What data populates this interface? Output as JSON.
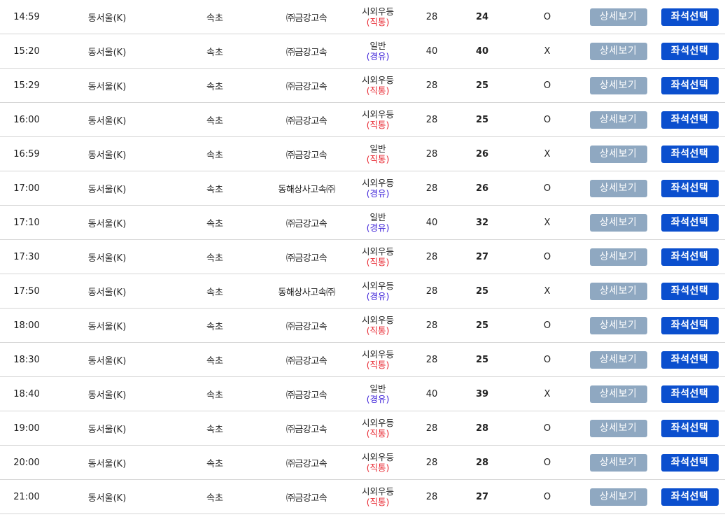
{
  "rows": [
    {
      "time": "14:59",
      "origin": "동서울(K)",
      "destination": "속초",
      "company": "㈜금강고속",
      "grade": "시외우등",
      "route": "(직통)",
      "route_type": "direct",
      "total_seats": "28",
      "remaining": "24",
      "mark": "O",
      "detail_label": "상세보기",
      "seat_label": "좌석선택"
    },
    {
      "time": "15:20",
      "origin": "동서울(K)",
      "destination": "속초",
      "company": "㈜금강고속",
      "grade": "일반",
      "route": "(경유)",
      "route_type": "via",
      "total_seats": "40",
      "remaining": "40",
      "mark": "X",
      "detail_label": "상세보기",
      "seat_label": "좌석선택"
    },
    {
      "time": "15:29",
      "origin": "동서울(K)",
      "destination": "속초",
      "company": "㈜금강고속",
      "grade": "시외우등",
      "route": "(직통)",
      "route_type": "direct",
      "total_seats": "28",
      "remaining": "25",
      "mark": "O",
      "detail_label": "상세보기",
      "seat_label": "좌석선택"
    },
    {
      "time": "16:00",
      "origin": "동서울(K)",
      "destination": "속초",
      "company": "㈜금강고속",
      "grade": "시외우등",
      "route": "(직통)",
      "route_type": "direct",
      "total_seats": "28",
      "remaining": "25",
      "mark": "O",
      "detail_label": "상세보기",
      "seat_label": "좌석선택"
    },
    {
      "time": "16:59",
      "origin": "동서울(K)",
      "destination": "속초",
      "company": "㈜금강고속",
      "grade": "일반",
      "route": "(직통)",
      "route_type": "direct",
      "total_seats": "28",
      "remaining": "26",
      "mark": "X",
      "detail_label": "상세보기",
      "seat_label": "좌석선택"
    },
    {
      "time": "17:00",
      "origin": "동서울(K)",
      "destination": "속초",
      "company": "동해상사고속㈜",
      "grade": "시외우등",
      "route": "(경유)",
      "route_type": "via",
      "total_seats": "28",
      "remaining": "26",
      "mark": "O",
      "detail_label": "상세보기",
      "seat_label": "좌석선택"
    },
    {
      "time": "17:10",
      "origin": "동서울(K)",
      "destination": "속초",
      "company": "㈜금강고속",
      "grade": "일반",
      "route": "(경유)",
      "route_type": "via",
      "total_seats": "40",
      "remaining": "32",
      "mark": "X",
      "detail_label": "상세보기",
      "seat_label": "좌석선택"
    },
    {
      "time": "17:30",
      "origin": "동서울(K)",
      "destination": "속초",
      "company": "㈜금강고속",
      "grade": "시외우등",
      "route": "(직통)",
      "route_type": "direct",
      "total_seats": "28",
      "remaining": "27",
      "mark": "O",
      "detail_label": "상세보기",
      "seat_label": "좌석선택"
    },
    {
      "time": "17:50",
      "origin": "동서울(K)",
      "destination": "속초",
      "company": "동해상사고속㈜",
      "grade": "시외우등",
      "route": "(경유)",
      "route_type": "via",
      "total_seats": "28",
      "remaining": "25",
      "mark": "X",
      "detail_label": "상세보기",
      "seat_label": "좌석선택"
    },
    {
      "time": "18:00",
      "origin": "동서울(K)",
      "destination": "속초",
      "company": "㈜금강고속",
      "grade": "시외우등",
      "route": "(직통)",
      "route_type": "direct",
      "total_seats": "28",
      "remaining": "25",
      "mark": "O",
      "detail_label": "상세보기",
      "seat_label": "좌석선택"
    },
    {
      "time": "18:30",
      "origin": "동서울(K)",
      "destination": "속초",
      "company": "㈜금강고속",
      "grade": "시외우등",
      "route": "(직통)",
      "route_type": "direct",
      "total_seats": "28",
      "remaining": "25",
      "mark": "O",
      "detail_label": "상세보기",
      "seat_label": "좌석선택"
    },
    {
      "time": "18:40",
      "origin": "동서울(K)",
      "destination": "속초",
      "company": "㈜금강고속",
      "grade": "일반",
      "route": "(경유)",
      "route_type": "via",
      "total_seats": "40",
      "remaining": "39",
      "mark": "X",
      "detail_label": "상세보기",
      "seat_label": "좌석선택"
    },
    {
      "time": "19:00",
      "origin": "동서울(K)",
      "destination": "속초",
      "company": "㈜금강고속",
      "grade": "시외우등",
      "route": "(직통)",
      "route_type": "direct",
      "total_seats": "28",
      "remaining": "28",
      "mark": "O",
      "detail_label": "상세보기",
      "seat_label": "좌석선택"
    },
    {
      "time": "20:00",
      "origin": "동서울(K)",
      "destination": "속초",
      "company": "㈜금강고속",
      "grade": "시외우등",
      "route": "(직통)",
      "route_type": "direct",
      "total_seats": "28",
      "remaining": "28",
      "mark": "O",
      "detail_label": "상세보기",
      "seat_label": "좌석선택"
    },
    {
      "time": "21:00",
      "origin": "동서울(K)",
      "destination": "속초",
      "company": "㈜금강고속",
      "grade": "시외우등",
      "route": "(직통)",
      "route_type": "direct",
      "total_seats": "28",
      "remaining": "27",
      "mark": "O",
      "detail_label": "상세보기",
      "seat_label": "좌석선택"
    }
  ],
  "colors": {
    "direct": "#e8262f",
    "via": "#3e22d9",
    "detail_button": "#8fa8c1",
    "seat_button": "#0b4fce"
  }
}
